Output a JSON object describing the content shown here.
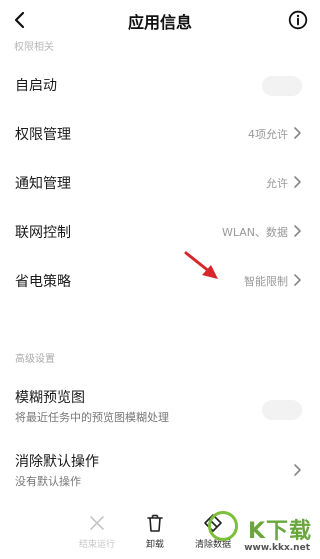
{
  "header": {
    "title": "应用信息",
    "back_icon": "chevron-left-icon",
    "info_icon": "info-circle-icon"
  },
  "cut_label": "权限相关",
  "rows": [
    {
      "label": "自启动",
      "value": "",
      "has_chevron": false
    },
    {
      "label": "权限管理",
      "value": "4项允许",
      "has_chevron": true
    },
    {
      "label": "通知管理",
      "value": "允许",
      "has_chevron": true
    },
    {
      "label": "联网控制",
      "value": "WLAN、数据",
      "has_chevron": true
    },
    {
      "label": "省电策略",
      "value": "智能限制",
      "has_chevron": true
    }
  ],
  "advanced": {
    "section_title": "高级设置",
    "blur_preview": {
      "title": "模糊预览图",
      "subtitle": "将最近任务中的预览图模糊处理"
    },
    "clear_defaults": {
      "title": "消除默认操作",
      "subtitle": "没有默认操作"
    }
  },
  "toolbar": {
    "items": [
      {
        "label": "结束运行",
        "icon": "close-x-icon",
        "enabled": false
      },
      {
        "label": "卸载",
        "icon": "trash-icon",
        "enabled": true
      },
      {
        "label": "清除数据",
        "icon": "eraser-icon",
        "enabled": true
      }
    ]
  },
  "watermark": {
    "text": "K下载",
    "url": "www.kkx.net"
  },
  "colors": {
    "annotation_arrow": "#d9262b",
    "watermark_green": "#6aa63b"
  }
}
